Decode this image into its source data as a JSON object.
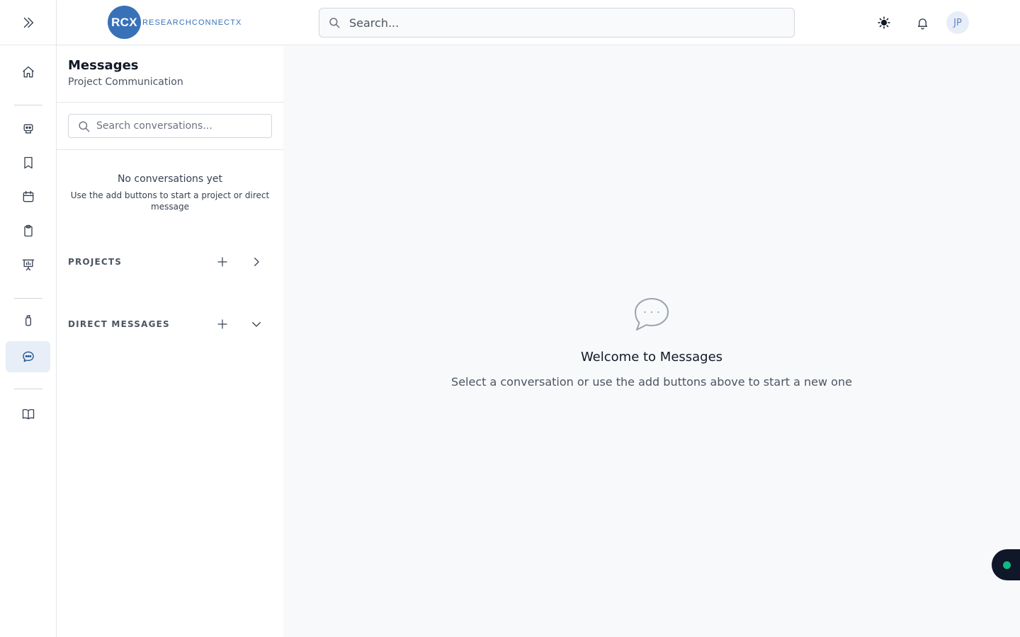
{
  "brand": {
    "logo_mark": "RCX",
    "logo_text": "RESEARCHCONNECTX",
    "color": "#3871b8"
  },
  "header": {
    "search_placeholder": "Search...",
    "theme_icon": "sun-icon",
    "notifications_icon": "bell-icon",
    "avatar_initials": "JP"
  },
  "nav_rail": {
    "toggle_icon": "chevrons-right-icon",
    "items": [
      {
        "icon": "home-icon",
        "active": false
      },
      {
        "icon": "robot-icon",
        "active": false
      },
      {
        "icon": "bookmark-icon",
        "active": false
      },
      {
        "icon": "calendar-icon",
        "active": false
      },
      {
        "icon": "clipboard-icon",
        "active": false
      },
      {
        "icon": "presentation-chart-icon",
        "active": false
      },
      {
        "icon": "flask-icon",
        "active": false
      },
      {
        "icon": "chat-bubble-icon",
        "active": true
      },
      {
        "icon": "book-open-icon",
        "active": false
      }
    ]
  },
  "messages_panel": {
    "title": "Messages",
    "subtitle": "Project Communication",
    "search_placeholder": "Search conversations...",
    "empty_title": "No conversations yet",
    "empty_description": "Use the add buttons to start a project or direct message",
    "sections": {
      "projects": {
        "label": "PROJECTS",
        "expanded": false
      },
      "direct_messages": {
        "label": "DIRECT MESSAGES",
        "expanded": true
      }
    }
  },
  "main": {
    "welcome_title": "Welcome to Messages",
    "welcome_subtitle": "Select a conversation or use the add buttons above to start a new one"
  },
  "colors": {
    "accent": "#3871b8",
    "active_nav_bg": "#e8eef7",
    "status_online": "#10b981",
    "fab_bg": "#0f1729"
  }
}
